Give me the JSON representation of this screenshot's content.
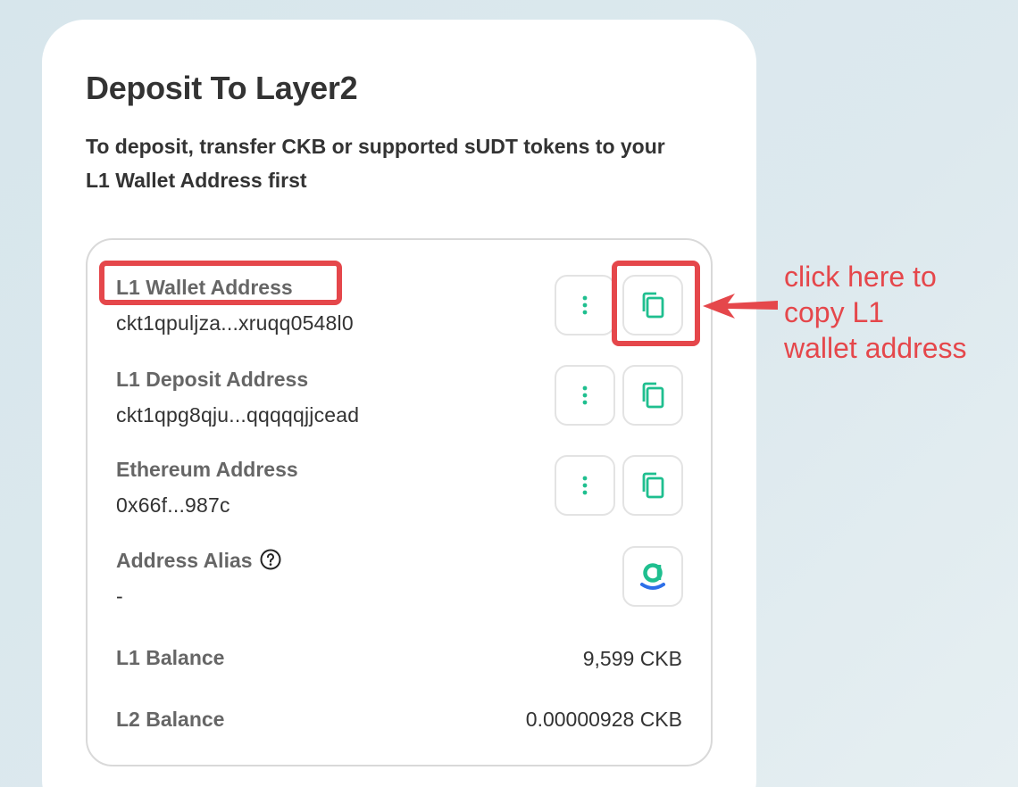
{
  "page": {
    "title": "Deposit To Layer2",
    "description": "To deposit, transfer CKB or supported sUDT tokens to your L1 Wallet Address first"
  },
  "addresses": {
    "l1_wallet": {
      "label": "L1 Wallet Address",
      "value": "ckt1qpuljza...xruqq0548l0"
    },
    "l1_deposit": {
      "label": "L1 Deposit Address",
      "value": "ckt1qpg8qju...qqqqqjjcead"
    },
    "ethereum": {
      "label": "Ethereum Address",
      "value": "0x66f...987c"
    },
    "alias": {
      "label": "Address Alias",
      "value": "-"
    }
  },
  "balances": {
    "l1": {
      "label": "L1 Balance",
      "value": "9,599 CKB"
    },
    "l2": {
      "label": "L2 Balance",
      "value": "0.00000928 CKB"
    }
  },
  "icons": {
    "more": "vertical-dots-icon",
    "copy": "copy-icon",
    "alias": "dotbit-alias-icon",
    "help": "question-circle-icon"
  },
  "annotation": {
    "text": "click here to\ncopy L1\nwallet address"
  },
  "colors": {
    "accent": "#1fbf8f",
    "annotation": "#e5474b",
    "alias_blue": "#2d6fe8"
  }
}
